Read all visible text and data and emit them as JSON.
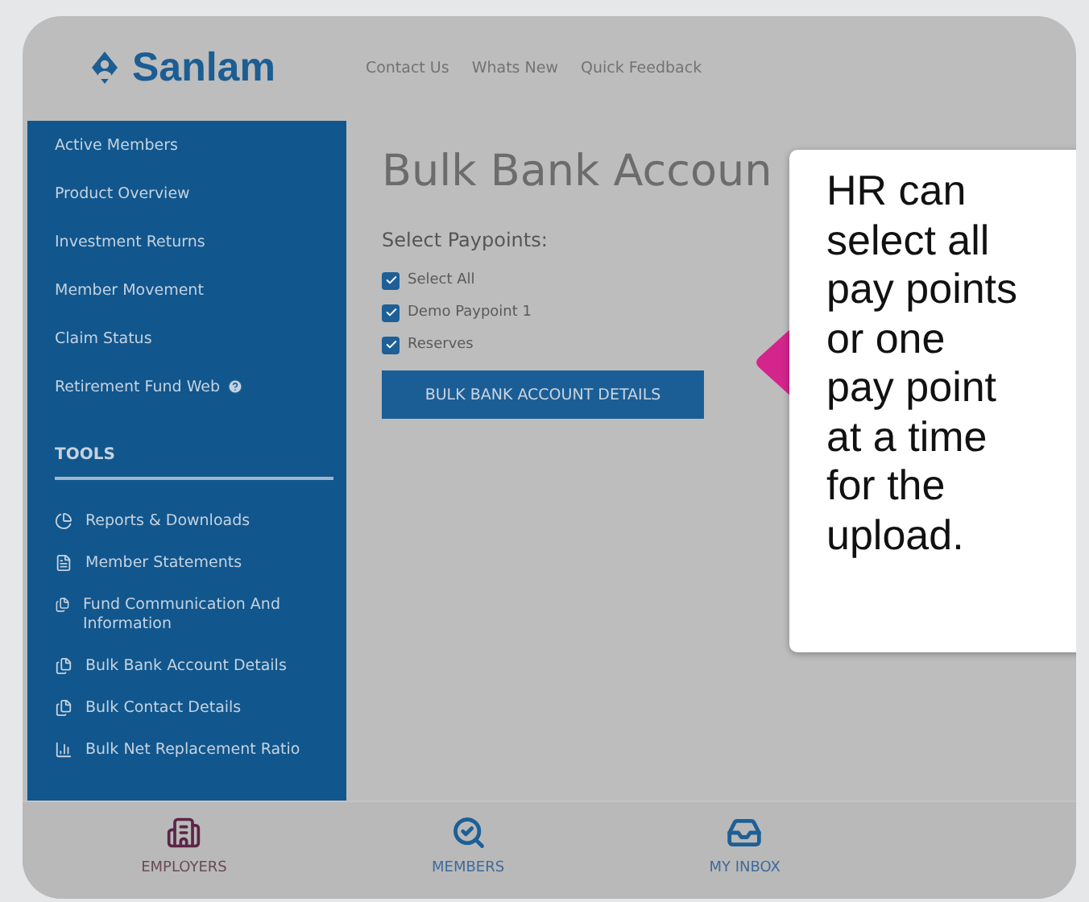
{
  "header": {
    "logo": "Sanlam",
    "links": [
      "Contact Us",
      "Whats New",
      "Quick Feedback"
    ]
  },
  "sidebar": {
    "items": [
      {
        "label": "Active Members",
        "help": false
      },
      {
        "label": "Product Overview",
        "help": false
      },
      {
        "label": "Investment Returns",
        "help": false
      },
      {
        "label": "Member Movement",
        "help": false
      },
      {
        "label": "Claim Status",
        "help": false
      },
      {
        "label": "Retirement Fund Web",
        "help": true
      }
    ],
    "tools_heading": "TOOLS",
    "tools": [
      {
        "label": "Reports & Downloads",
        "kind": "pie"
      },
      {
        "label": "Member Statements",
        "kind": "document"
      },
      {
        "label": "Fund Communication And Information",
        "kind": "files"
      },
      {
        "label": "Bulk Bank Account Details",
        "kind": "files"
      },
      {
        "label": "Bulk Contact Details",
        "kind": "files"
      },
      {
        "label": "Bulk Net Replacement Ratio",
        "kind": "chart"
      }
    ]
  },
  "page": {
    "title": "Bulk Bank Accoun",
    "section_label": "Select Paypoints:",
    "paypoints": [
      {
        "label": "Select All",
        "checked": true
      },
      {
        "label": "Demo Paypoint 1",
        "checked": true
      },
      {
        "label": "Reserves",
        "checked": true
      }
    ],
    "button": "BULK BANK ACCOUNT DETAILS"
  },
  "callout": {
    "text": "HR can select all pay points or one pay point at a time for the upload."
  },
  "bottom_nav": [
    {
      "label": "EMPLOYERS",
      "kind": "building",
      "selected": true
    },
    {
      "label": "MEMBERS",
      "kind": "member-search",
      "selected": false
    },
    {
      "label": "MY INBOX",
      "kind": "inbox",
      "selected": false
    }
  ]
}
